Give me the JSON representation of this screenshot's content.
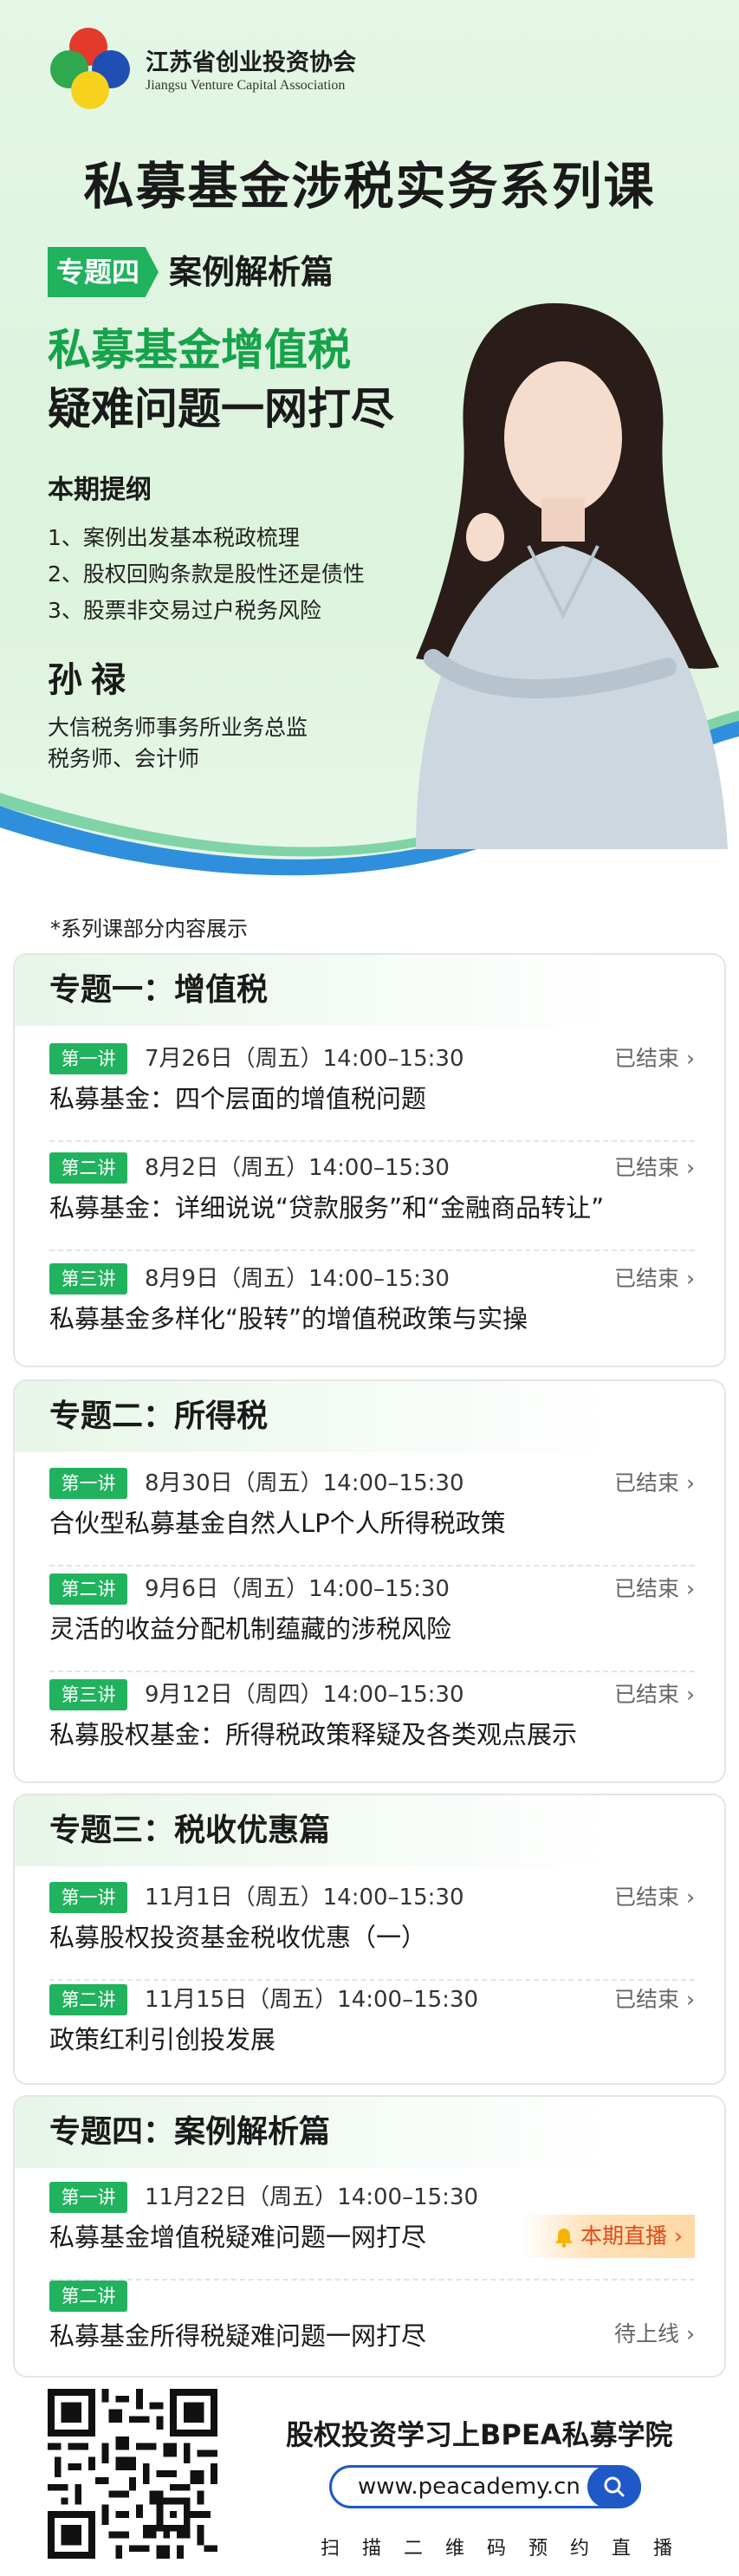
{
  "colors": {
    "green": "#21b25e",
    "headline_green": "#16a34a",
    "yellow_highlight": "#f5d77a",
    "link_blue": "#1f59c7",
    "live_orange": "#e24a1b"
  },
  "header": {
    "assoc_cn": "江苏省创业投资协会",
    "assoc_en": "Jiangsu Venture Capital Association",
    "main_title": "私募基金涉税实务系列课",
    "topic_tag": "专题四",
    "topic_sub": "案例解析篇",
    "headline_1": "私募基金增值税",
    "headline_2": "疑难问题一网打尽",
    "outline_title": "本期提纲",
    "outline": [
      "1、案例出发基本税政梳理",
      "2、股权回购条款是股性还是债性",
      "3、股票非交易过户税务风险"
    ],
    "speaker_name": "孙禄",
    "speaker_info_1": "大信税务师事务所业务总监",
    "speaker_info_2": "税务师、会计师"
  },
  "note": "*系列课部分内容展示",
  "cards": [
    {
      "title": "专题一：增值税",
      "lectures": [
        {
          "badge": "第一讲",
          "time": "7月26日（周五）14:00–15:30",
          "status": "已结束",
          "title": "私募基金：四个层面的增值税问题"
        },
        {
          "badge": "第二讲",
          "time": "8月2日（周五）14:00–15:30",
          "status": "已结束",
          "title": "私募基金：详细说说“贷款服务”和“金融商品转让”"
        },
        {
          "badge": "第三讲",
          "time": "8月9日（周五）14:00–15:30",
          "status": "已结束",
          "title": "私募基金多样化“股转”的增值税政策与实操"
        }
      ]
    },
    {
      "title": "专题二：所得税",
      "lectures": [
        {
          "badge": "第一讲",
          "time": "8月30日（周五）14:00–15:30",
          "status": "已结束",
          "title": "合伙型私募基金自然人LP个人所得税政策"
        },
        {
          "badge": "第二讲",
          "time": "9月6日（周五）14:00–15:30",
          "status": "已结束",
          "title": "灵活的收益分配机制蕴藏的涉税风险"
        },
        {
          "badge": "第三讲",
          "time": "9月12日（周四）14:00–15:30",
          "status": "已结束",
          "title": "私募股权基金：所得税政策释疑及各类观点展示"
        }
      ]
    },
    {
      "title": "专题三：税收优惠篇",
      "lectures": [
        {
          "badge": "第一讲",
          "time": "11月1日（周五）14:00–15:30",
          "status": "已结束",
          "title": "私募股权投资基金税收优惠（一）"
        },
        {
          "badge": "第二讲",
          "time": "11月15日（周五）14:00–15:30",
          "status": "已结束",
          "title": "政策红利引创投发展"
        }
      ]
    },
    {
      "title": "专题四：案例解析篇",
      "lectures": [
        {
          "badge": "第一讲",
          "time": "11月22日（周五）14:00–15:30",
          "status": "本期直播",
          "title": "私募基金增值税疑难问题一网打尽"
        },
        {
          "badge": "第二讲",
          "time": "",
          "status": "待上线",
          "title": "私募基金所得税疑难问题一网打尽"
        }
      ]
    }
  ],
  "footer": {
    "slogan": "股权投资学习上BPEA私募学院",
    "url": "www.peacademy.cn",
    "scan": "扫描二维码预约直播"
  }
}
